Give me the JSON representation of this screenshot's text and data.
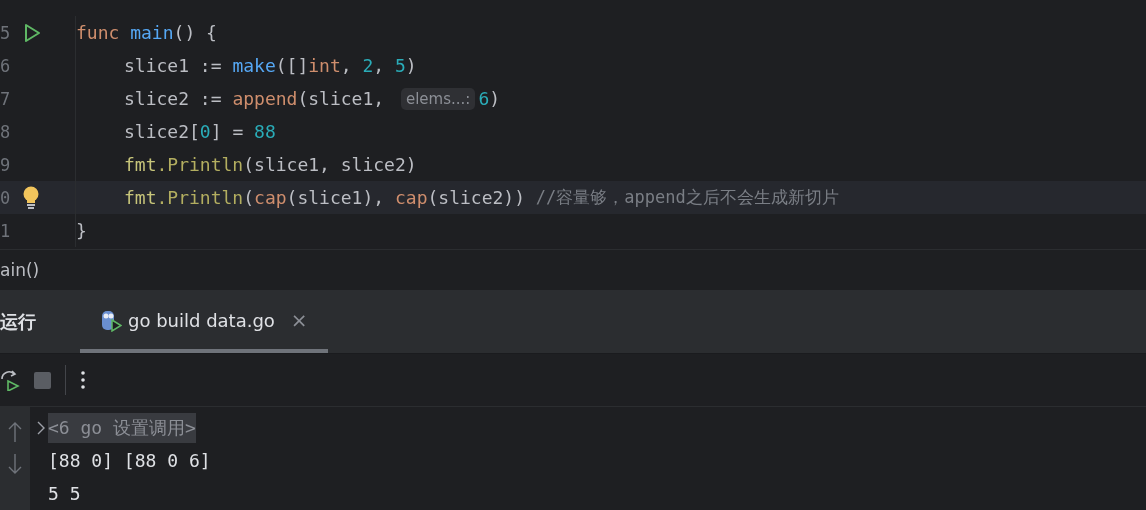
{
  "editor": {
    "lines": [
      {
        "number": "5",
        "gutter_icon": {
          "kind": "run"
        },
        "current": false,
        "indented": false,
        "segments": [
          {
            "kind": "code",
            "tokens": [
              {
                "t": "func ",
                "kind": "keyword"
              },
              {
                "t": "main",
                "kind": "function"
              },
              {
                "t": "() {",
                "kind": "plain"
              }
            ]
          }
        ]
      },
      {
        "number": "6",
        "current": false,
        "indented": true,
        "segments": [
          {
            "kind": "code",
            "tokens": [
              {
                "t": "slice1 := ",
                "kind": "plain"
              },
              {
                "t": "make",
                "kind": "function"
              },
              {
                "t": "([]",
                "kind": "plain"
              },
              {
                "t": "int",
                "kind": "keyword"
              },
              {
                "t": ", ",
                "kind": "plain"
              },
              {
                "t": "2",
                "kind": "number"
              },
              {
                "t": ", ",
                "kind": "plain"
              },
              {
                "t": "5",
                "kind": "number"
              },
              {
                "t": ")",
                "kind": "plain"
              }
            ]
          }
        ]
      },
      {
        "number": "7",
        "current": false,
        "indented": true,
        "segments": [
          {
            "kind": "code",
            "tokens": [
              {
                "t": "slice2 := ",
                "kind": "plain"
              },
              {
                "t": "append",
                "kind": "keyword"
              },
              {
                "t": "(slice1, ",
                "kind": "plain"
              }
            ]
          },
          {
            "kind": "hint",
            "text": "elems...:"
          },
          {
            "kind": "code",
            "tokens": [
              {
                "t": "6",
                "kind": "number"
              },
              {
                "t": ")",
                "kind": "plain"
              }
            ]
          }
        ]
      },
      {
        "number": "8",
        "current": false,
        "indented": true,
        "segments": [
          {
            "kind": "code",
            "tokens": [
              {
                "t": "slice2[",
                "kind": "plain"
              },
              {
                "t": "0",
                "kind": "number"
              },
              {
                "t": "] = ",
                "kind": "plain"
              },
              {
                "t": "88",
                "kind": "number"
              }
            ]
          }
        ]
      },
      {
        "number": "9",
        "current": false,
        "indented": true,
        "segments": [
          {
            "kind": "code",
            "tokens": [
              {
                "t": "fmt",
                "kind": "package"
              },
              {
                "t": ".Println",
                "kind": "method"
              },
              {
                "t": "(slice1, slice2)",
                "kind": "plain"
              }
            ]
          }
        ]
      },
      {
        "number": "0",
        "gutter_icon": {
          "kind": "bulb"
        },
        "current": true,
        "indented": true,
        "segments": [
          {
            "kind": "code",
            "tokens": [
              {
                "t": "fmt",
                "kind": "package"
              },
              {
                "t": ".Println",
                "kind": "method"
              },
              {
                "t": "(",
                "kind": "plain"
              },
              {
                "t": "cap",
                "kind": "keyword"
              },
              {
                "t": "(slice1), ",
                "kind": "plain"
              },
              {
                "t": "cap",
                "kind": "keyword"
              },
              {
                "t": "(slice2)) ",
                "kind": "plain"
              }
            ]
          },
          {
            "kind": "comment",
            "text": "//容量够，append之后不会生成新切片"
          }
        ]
      },
      {
        "number": "1",
        "current": false,
        "indented": false,
        "segments": [
          {
            "kind": "code",
            "tokens": [
              {
                "t": "}",
                "kind": "plain"
              }
            ]
          }
        ]
      }
    ]
  },
  "breadcrumb": "ain()",
  "run_panel": {
    "title": "运行",
    "tabs": [
      {
        "label": "go build data.go",
        "selected": true,
        "close": "×"
      }
    ],
    "console": [
      {
        "kind": "fold",
        "text": "<6 go 设置调用>"
      },
      {
        "kind": "output",
        "text": "[88 0] [88 0 6]"
      },
      {
        "kind": "output",
        "text": "5 5"
      }
    ]
  }
}
